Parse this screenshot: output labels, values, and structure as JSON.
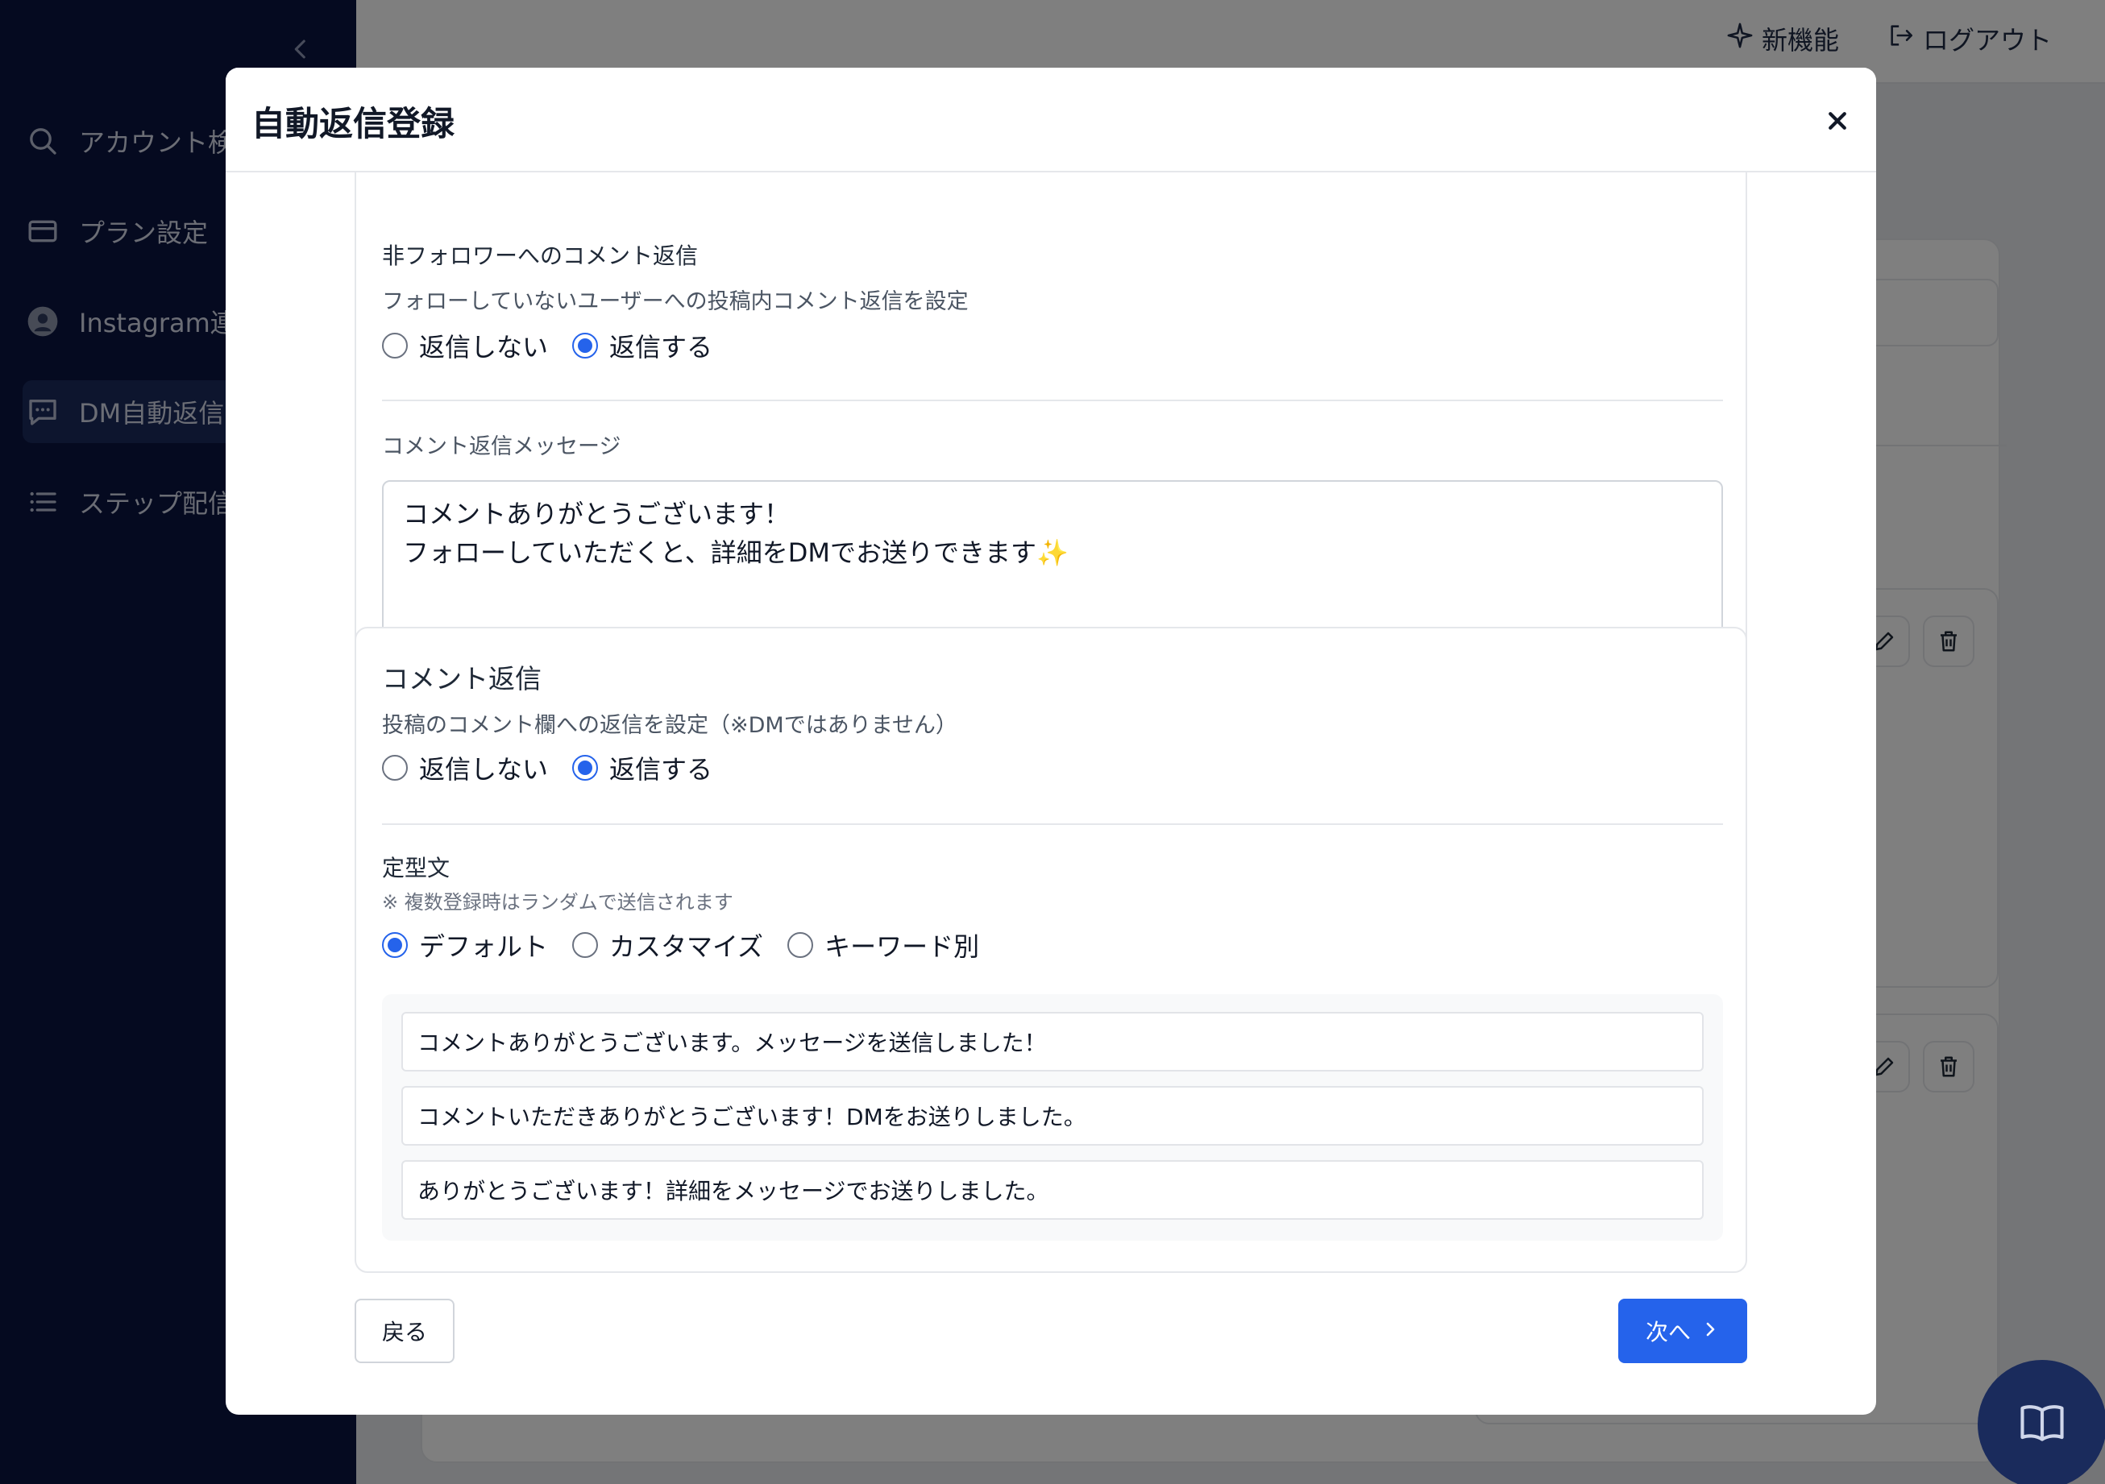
{
  "sidebar": {
    "collapse_icon": "chevron-left-icon",
    "items": [
      {
        "label": "アカウント検",
        "icon": "search-icon"
      },
      {
        "label": "プラン設定",
        "icon": "card-icon"
      },
      {
        "label": "Instagram連",
        "icon": "avatar-icon"
      },
      {
        "label": "DM自動返信",
        "icon": "chat-icon"
      },
      {
        "label": "ステップ配信",
        "icon": "list-icon"
      }
    ]
  },
  "header": {
    "new_features": "新機能",
    "logout": "ログアウト"
  },
  "modal": {
    "title": "自動返信登録",
    "close_label": "×",
    "non_follower": {
      "title": "非フォロワーへのコメント返信",
      "desc": "フォローしていないユーザーへの投稿内コメント返信を設定",
      "options": [
        "返信しない",
        "返信する"
      ],
      "selected_index": 1,
      "message_label": "コメント返信メッセージ",
      "message_line1": "コメントありがとうございます！",
      "message_line2": "フォローしていただくと、詳細をDMでお送りできます",
      "message_emoji": "✨"
    },
    "comment_reply": {
      "title": "コメント返信",
      "desc": "投稿のコメント欄への返信を設定（※DMではありません）",
      "options": [
        "返信しない",
        "返信する"
      ],
      "selected_index": 1,
      "template_label": "定型文",
      "template_note": "※ 複数登録時はランダムで送信されます",
      "template_options": [
        "デフォルト",
        "カスタマイズ",
        "キーワード別"
      ],
      "template_selected_index": 0,
      "templates": [
        "コメントありがとうございます。メッセージを送信しました！",
        "コメントいただきありがとうございます！DMをお送りしました。",
        "ありがとうございます！詳細をメッセージでお送りしました。"
      ]
    },
    "back_button": "戻る",
    "next_button": "次へ"
  },
  "help_icon": "book-icon"
}
